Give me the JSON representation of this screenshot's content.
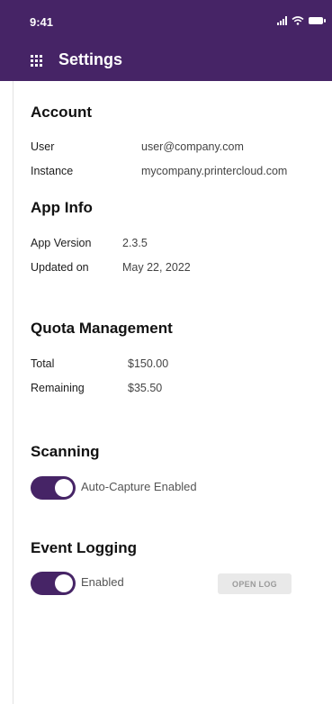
{
  "status_bar": {
    "time": "9:41"
  },
  "header": {
    "title": "Settings",
    "background": "#462466"
  },
  "account": {
    "title": "Account",
    "rows": [
      {
        "label": "User",
        "value": "user@company.com"
      },
      {
        "label": "Instance",
        "value": "mycompany.printercloud.com"
      }
    ]
  },
  "app_info": {
    "title": "App Info",
    "rows": [
      {
        "label": "App Version",
        "value": "2.3.5"
      },
      {
        "label": "Updated on",
        "value": "May 22, 2022"
      }
    ]
  },
  "quota": {
    "title": "Quota Management",
    "rows": [
      {
        "label": "Total",
        "value": "$150.00"
      },
      {
        "label": "Remaining",
        "value": "$35.50"
      }
    ]
  },
  "scanning": {
    "title": "Scanning",
    "toggle_label": "Auto-Capture Enabled",
    "toggle_on": true
  },
  "event_logging": {
    "title": "Event Logging",
    "toggle_label": "Enabled",
    "toggle_on": true,
    "open_log_label": "OPEN LOG"
  }
}
